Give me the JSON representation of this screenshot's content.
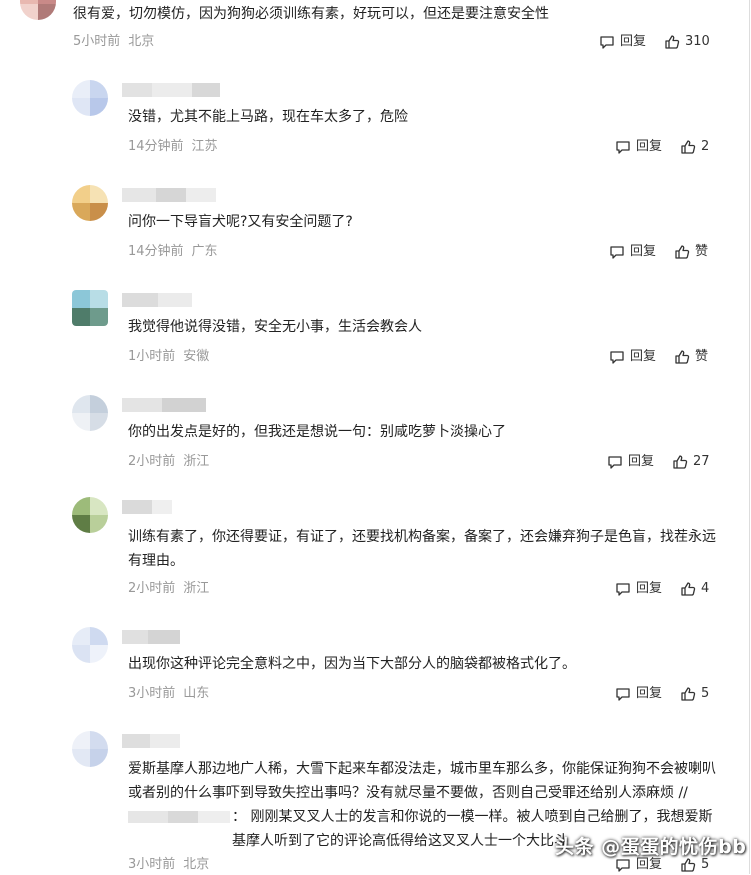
{
  "comments": [
    {
      "text": "很有爱，切勿模仿，因为狗狗必须训练有素，好玩可以，但还是要注意安全性",
      "time": "5小时前",
      "location": "北京",
      "reply_label": "回复",
      "like_label": "310"
    },
    {
      "text": "没错，尤其不能上马路，现在车太多了，危险",
      "time": "14分钟前",
      "location": "江苏",
      "reply_label": "回复",
      "like_label": "2"
    },
    {
      "text": "问你一下导盲犬呢?又有安全问题了?",
      "time": "14分钟前",
      "location": "广东",
      "reply_label": "回复",
      "like_label": "赞"
    },
    {
      "text": "我觉得他说得没错，安全无小事，生活会教会人",
      "time": "1小时前",
      "location": "安徽",
      "reply_label": "回复",
      "like_label": "赞"
    },
    {
      "text": "你的出发点是好的，但我还是想说一句：别咸吃萝卜淡操心了",
      "time": "2小时前",
      "location": "浙江",
      "reply_label": "回复",
      "like_label": "27"
    },
    {
      "text": "训练有素了，你还得要证，有证了，还要找机构备案，备案了，还会嫌弃狗子是色盲，找茬永远有理由。",
      "time": "2小时前",
      "location": "浙江",
      "reply_label": "回复",
      "like_label": "4"
    },
    {
      "text": "出现你这种评论完全意料之中，因为当下大部分人的脑袋都被格式化了。",
      "time": "3小时前",
      "location": "山东",
      "reply_label": "回复",
      "like_label": "5"
    },
    {
      "text": "爱斯基摩人那边地广人稀，大雪下起来车都没法走，城市里车那么多，你能保证狗狗不会被喇叭或者别的什么事吓到导致失控出事吗？没有就尽量不要做，否则自己受罪还给别人添麻烦 //",
      "quote": "：  刚刚某叉叉人士的发言和你说的一模一样。被人喷到自己给删了，我想爱斯基摩人听到了它的评论高低得给这叉叉人士一个大比斗",
      "time": "3小时前",
      "location": "北京",
      "reply_label": "回复",
      "like_label": "5"
    }
  ],
  "watermark": "头条 @蛋蛋的忧伤bb",
  "colors": {
    "meta": "#999999",
    "text": "#222222",
    "border": "#dddddd"
  }
}
